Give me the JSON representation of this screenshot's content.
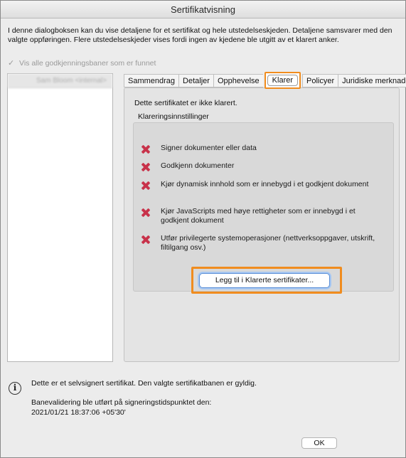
{
  "window": {
    "title": "Sertifikatvisning"
  },
  "intro_text": "I denne dialogboksen kan du vise detaljene for et sertifikat og hele utstedelseskjeden. Detaljene samsvarer med den valgte oppføringen. Flere utstedelseskjeder vises fordi ingen av kjedene ble utgitt av et klarert anker.",
  "show_all_paths": {
    "label": "Vis alle godkjenningsbaner som er funnet",
    "checked": true,
    "enabled": false
  },
  "certificate_path": {
    "items": [
      "Sam Bloom <internal>"
    ]
  },
  "tabs": [
    {
      "label": "Sammendrag",
      "active": false
    },
    {
      "label": "Detaljer",
      "active": false
    },
    {
      "label": "Opphevelse",
      "active": false
    },
    {
      "label": "Klarer",
      "active": true
    },
    {
      "label": "Policyer",
      "active": false
    },
    {
      "label": "Juridiske merknader",
      "active": false
    }
  ],
  "trust_tab": {
    "status": "Dette sertifikatet er ikke klarert.",
    "settings_label": "Klareringsinnstillinger",
    "items": [
      {
        "label": "Signer dokumenter eller data",
        "allowed": false,
        "icon": "x-icon"
      },
      {
        "label": "Godkjenn dokumenter",
        "allowed": false,
        "icon": "x-icon"
      },
      {
        "label": "Kjør dynamisk innhold som er innebygd i et godkjent dokument",
        "allowed": false,
        "icon": "x-icon"
      },
      {
        "label": "Kjør JavaScripts med høye rettigheter som er innebygd i et godkjent dokument",
        "allowed": false,
        "icon": "x-icon"
      },
      {
        "label": "Utfør privilegerte systemoperasjoner (nettverksoppgaver, utskrift, filtilgang osv.)",
        "allowed": false,
        "icon": "x-icon"
      }
    ],
    "add_button_label": "Legg til i Klarerte sertifikater..."
  },
  "footer": {
    "info_icon": "info-icon",
    "self_signed_text": "Dette er et selvsignert sertifikat. Den valgte sertifikatbanen er gyldig.",
    "validation_label": "Banevalidering ble utført på signeringstidspunktet den:",
    "validation_time": "2021/01/21 18:37:06 +05'30'",
    "ok_label": "OK"
  },
  "colors": {
    "highlight": "#f08c1e",
    "deny_icon": "#c8324a",
    "focus_ring": "#a8c8f2"
  }
}
